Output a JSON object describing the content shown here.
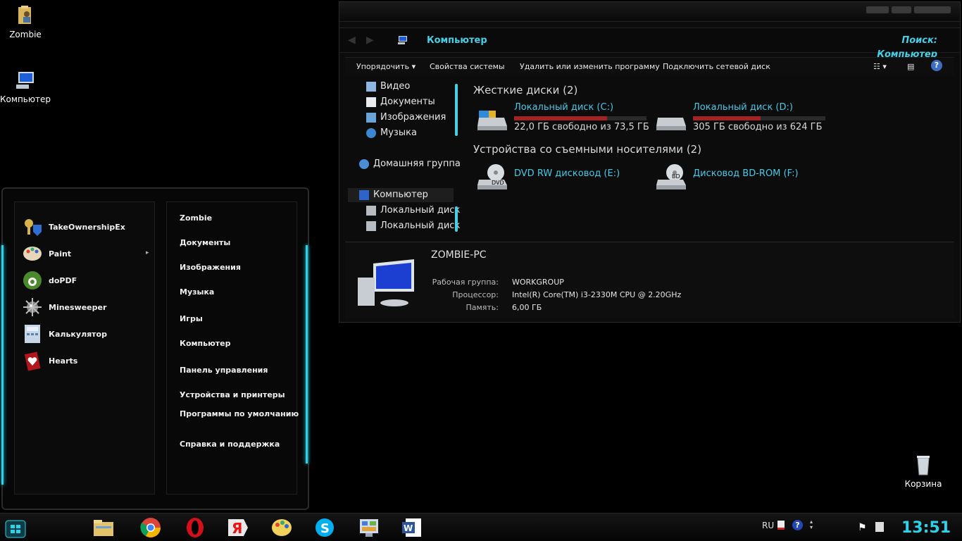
{
  "desktop": {
    "icons": [
      {
        "label": "Zombie",
        "icon": "folder-user-icon"
      },
      {
        "label": "Компьютер",
        "icon": "computer-icon"
      },
      {
        "label": "Корзина",
        "icon": "recycle-bin-icon"
      }
    ]
  },
  "explorer": {
    "address": "Компьютер",
    "search_placeholder": "Поиск: Компьютер",
    "toolbar": [
      "Упорядочить",
      "Свойства системы",
      "Удалить или изменить программу",
      "Подключить сетевой диск"
    ],
    "nav": [
      {
        "label": "Видео",
        "icon": "video-icon"
      },
      {
        "label": "Документы",
        "icon": "documents-icon"
      },
      {
        "label": "Изображения",
        "icon": "pictures-icon"
      },
      {
        "label": "Музыка",
        "icon": "music-icon"
      },
      {
        "label": "Домашняя группа",
        "icon": "homegroup-icon"
      },
      {
        "label": "Компьютер",
        "icon": "computer-icon"
      },
      {
        "label": "Локальный диск",
        "icon": "drive-icon"
      },
      {
        "label": "Локальный диск",
        "icon": "drive-icon"
      }
    ],
    "hard_disks_title": "Жесткие диски (2)",
    "removable_title": "Устройства со съемными носителями (2)",
    "drives": [
      {
        "name": "Локальный диск (C:)",
        "free": "22,0 ГБ свободно из 73,5 ГБ",
        "used_fraction": 0.7
      },
      {
        "name": "Локальный диск (D:)",
        "free": "305 ГБ свободно из 624 ГБ",
        "used_fraction": 0.51
      }
    ],
    "removable": [
      {
        "name": "DVD RW дисковод (E:)",
        "badge": "DVD"
      },
      {
        "name": "Дисковод BD-ROM (F:)",
        "badge": "BD"
      }
    ],
    "details": {
      "pc_name": "ZOMBIE-PC",
      "workgroup_label": "Рабочая группа:",
      "workgroup": "WORKGROUP",
      "cpu_label": "Процессор:",
      "cpu": "Intel(R) Core(TM) i3-2330M CPU @ 2.20GHz",
      "memory_label": "Память:",
      "memory": "6,00 ГБ"
    }
  },
  "startmenu": {
    "programs": [
      {
        "label": "TakeOwnershipEx",
        "icon": "key-shield-icon"
      },
      {
        "label": "Paint",
        "icon": "paint-palette-icon"
      },
      {
        "label": "doPDF",
        "icon": "dopdf-icon"
      },
      {
        "label": "Minesweeper",
        "icon": "mine-icon"
      },
      {
        "label": "Калькулятор",
        "icon": "calculator-icon"
      },
      {
        "label": "Hearts",
        "icon": "hearts-card-icon"
      }
    ],
    "links": [
      "Zombie",
      "Документы",
      "Изображения",
      "Музыка",
      "Игры",
      "Компьютер",
      "Панель управления",
      "Устройства и принтеры",
      "Программы по умолчанию",
      "Справка и поддержка"
    ]
  },
  "taskbar": {
    "apps": [
      "explorer-icon",
      "chrome-icon",
      "opera-icon",
      "yandex-icon",
      "paint-icon",
      "skype-icon",
      "control-panel-icon",
      "word-icon"
    ],
    "lang": "RU",
    "clock": "13:51",
    "accent": "#2bd3ea"
  }
}
